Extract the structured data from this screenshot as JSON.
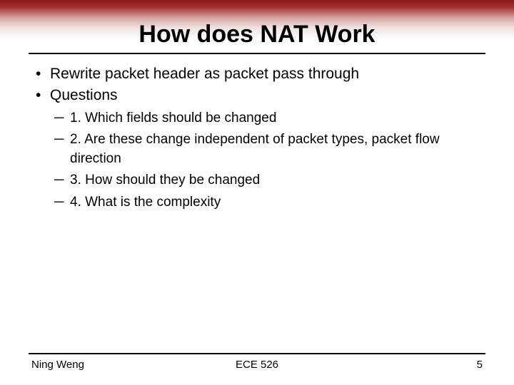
{
  "title": "How does NAT Work",
  "bullets_l1": [
    "Rewrite packet header as packet pass through",
    "Questions"
  ],
  "bullets_l2": [
    "1. Which fields should be changed",
    "2. Are these change independent of packet types, packet flow direction",
    "3. How should they be changed",
    "4. What is the complexity"
  ],
  "footer": {
    "left": "Ning Weng",
    "center": "ECE 526",
    "right": "5"
  }
}
